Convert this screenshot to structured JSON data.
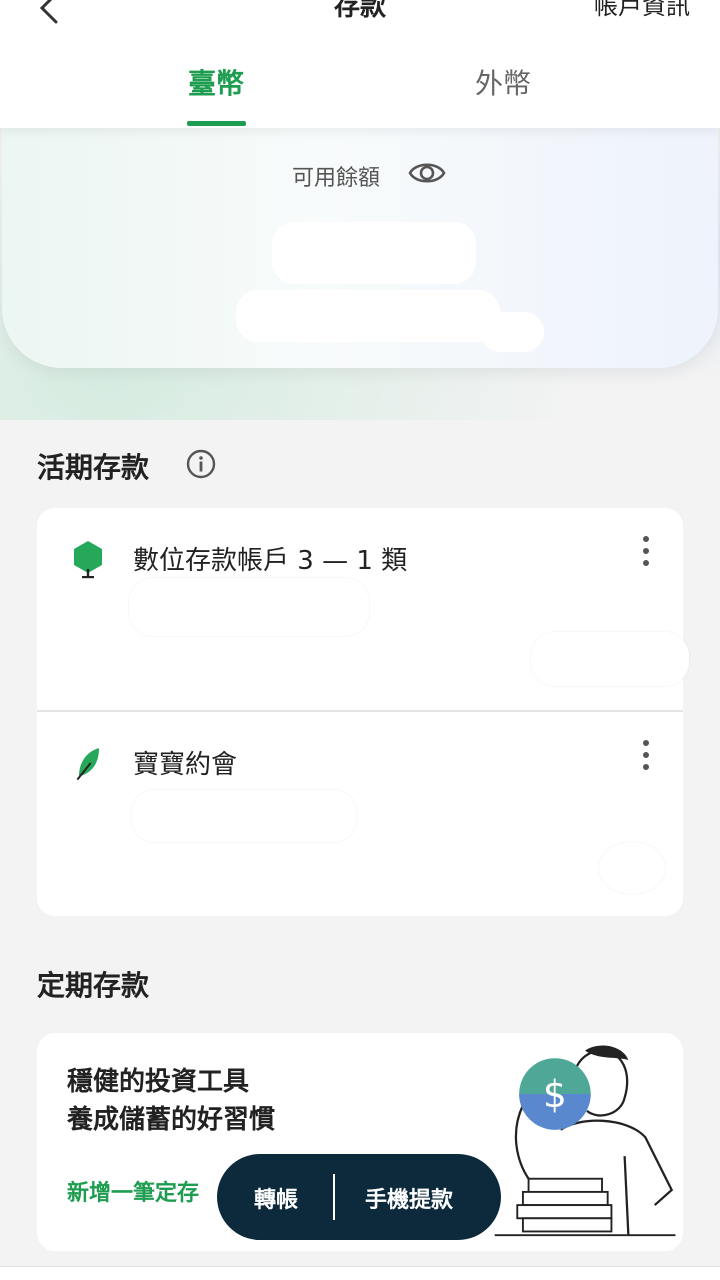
{
  "header": {
    "title": "存款",
    "action_label": "帳戶資訊"
  },
  "tabs": [
    {
      "label": "臺幣",
      "active": true
    },
    {
      "label": "外幣",
      "active": false
    }
  ],
  "balance": {
    "label": "可用餘額"
  },
  "demand_section": {
    "title": "活期存款",
    "accounts": [
      {
        "name": "數位存款帳戶 3 — 1 類",
        "icon": "tree-icon"
      },
      {
        "name": "寶寶約會",
        "icon": "leaf-icon"
      }
    ]
  },
  "fixed_section": {
    "title": "定期存款",
    "promo_line1": "穩健的投資工具",
    "promo_line2": "養成儲蓄的好習慣",
    "promo_link": "新增一筆定存"
  },
  "action_bar": {
    "transfer_label": "轉帳",
    "withdraw_label": "手機提款"
  },
  "colors": {
    "brand_green": "#1e9d50",
    "action_bar_bg": "#0d2a3c"
  }
}
